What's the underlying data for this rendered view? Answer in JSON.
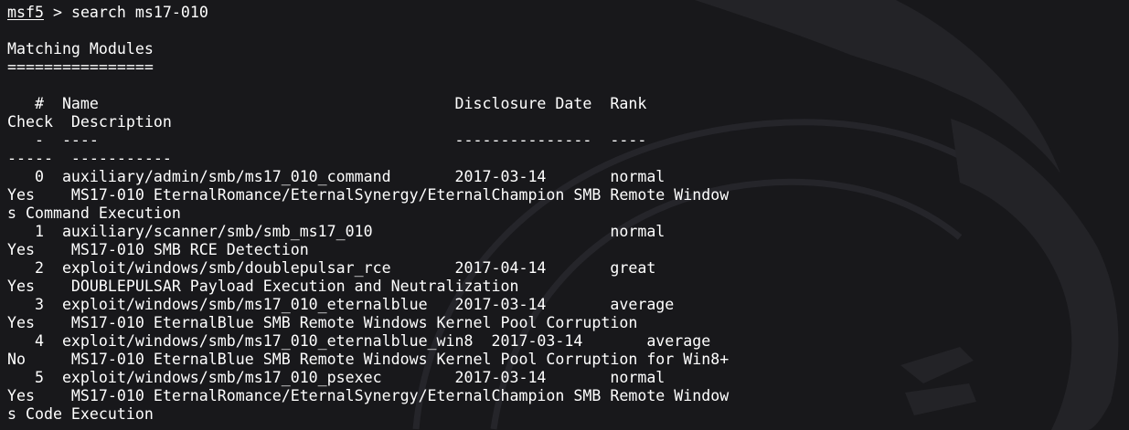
{
  "terminal": {
    "prompt": "msf5",
    "prompt_sep": " > ",
    "command": "search ms17-010",
    "lines": [
      "",
      "Matching Modules",
      "================",
      "",
      "   #  Name                                       Disclosure Date  Rank",
      "Check  Description",
      "   -  ----                                       ---------------  ----",
      "-----  -----------",
      "   0  auxiliary/admin/smb/ms17_010_command       2017-03-14       normal",
      "Yes    MS17-010 EternalRomance/EternalSynergy/EternalChampion SMB Remote Window",
      "s Command Execution",
      "   1  auxiliary/scanner/smb/smb_ms17_010                          normal",
      "Yes    MS17-010 SMB RCE Detection",
      "   2  exploit/windows/smb/doublepulsar_rce       2017-04-14       great",
      "Yes    DOUBLEPULSAR Payload Execution and Neutralization",
      "   3  exploit/windows/smb/ms17_010_eternalblue   2017-03-14       average",
      "Yes    MS17-010 EternalBlue SMB Remote Windows Kernel Pool Corruption",
      "   4  exploit/windows/smb/ms17_010_eternalblue_win8  2017-03-14       average",
      "No     MS17-010 EternalBlue SMB Remote Windows Kernel Pool Corruption for Win8+",
      "   5  exploit/windows/smb/ms17_010_psexec        2017-03-14       normal",
      "Yes    MS17-010 EternalRomance/EternalSynergy/EternalChampion SMB Remote Window",
      "s Code Execution"
    ]
  },
  "colors": {
    "background": "#18181b",
    "text": "#ffffff",
    "watermark": "#26262a"
  }
}
